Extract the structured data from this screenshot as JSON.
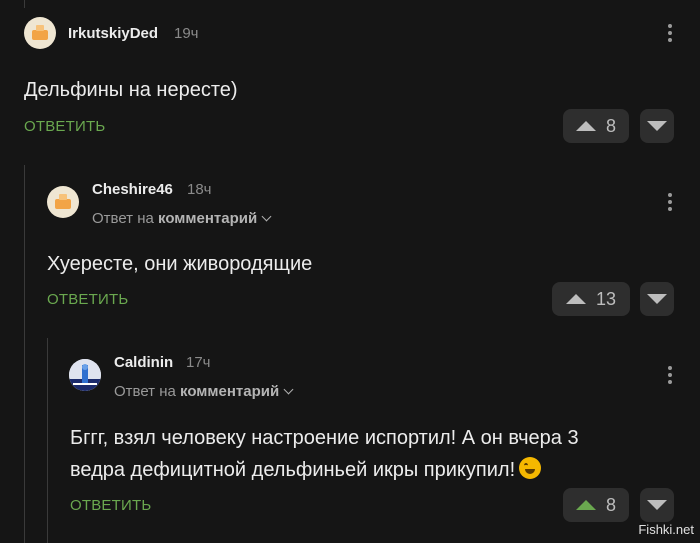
{
  "comments": [
    {
      "username": "IrkutskiyDed",
      "time": "19ч",
      "text": "Дельфины на нересте)",
      "reply_label": "ОТВЕТИТЬ",
      "votes": "8"
    },
    {
      "username": "Cheshire46",
      "time": "18ч",
      "reply_to_prefix": "Ответ на",
      "reply_to_target": "комментарий",
      "text": "Хуересте, они живородящие",
      "reply_label": "ОТВЕТИТЬ",
      "votes": "13"
    },
    {
      "username": "Caldinin",
      "time": "17ч",
      "reply_to_prefix": "Ответ на",
      "reply_to_target": "комментарий",
      "text_line1": "Бггг, взял человеку настроение испортил! А он вчера 3",
      "text_line2": "ведра дефицитной дельфиньей икры прикупил!",
      "emoji": "rolling-on-floor-laughing-emoji",
      "reply_label": "ОТВЕТИТЬ",
      "votes": "8"
    }
  ],
  "watermark": "Fishki.net",
  "colors": {
    "background": "#151515",
    "reply": "#6aa84f",
    "upvoted": "#6aa84f"
  }
}
